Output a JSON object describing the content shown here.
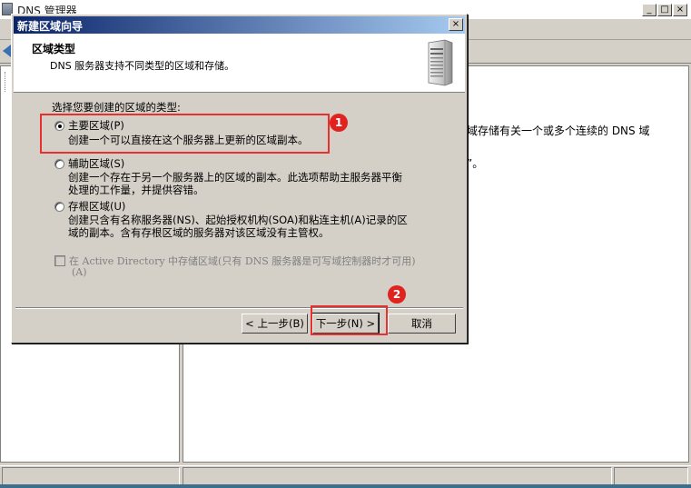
{
  "background_window": {
    "title": "DNS 管理器",
    "content_line1": "域存储有关一个或多个连续的 DNS 域",
    "content_line2": "”。"
  },
  "window_controls": {
    "minimize": "_",
    "maximize": "□",
    "close": "×"
  },
  "dialog": {
    "title": "新建区域向导",
    "header_title": "区域类型",
    "header_subtitle": "DNS 服务器支持不同类型的区域和存储。",
    "prompt": "选择您要创建的区域的类型:",
    "options": [
      {
        "label": "主要区域(P)",
        "description": [
          "创建一个可以直接在这个服务器上更新的区域副本。"
        ],
        "selected": true
      },
      {
        "label": "辅助区域(S)",
        "description": [
          "创建一个存在于另一个服务器上的区域的副本。此选项帮助主服务器平衡",
          "处理的工作量，并提供容错。"
        ],
        "selected": false
      },
      {
        "label": "存根区域(U)",
        "description": [
          "创建只含有名称服务器(NS)、起始授权机构(SOA)和粘连主机(A)记录的区",
          "域的副本。含有存根区域的服务器对该区域没有主管权。"
        ],
        "selected": false
      }
    ],
    "ad_checkbox": {
      "line1": "在 Active Directory 中存储区域(只有 DNS 服务器是可写域控制器时才可用)",
      "line2": "(A)",
      "enabled": false,
      "checked": false
    },
    "buttons": {
      "back": "< 上一步(B)",
      "next": "下一步(N) >",
      "cancel": "取消"
    }
  },
  "annotations": {
    "badge1": "1",
    "badge2": "2",
    "color": "#e8312f"
  }
}
